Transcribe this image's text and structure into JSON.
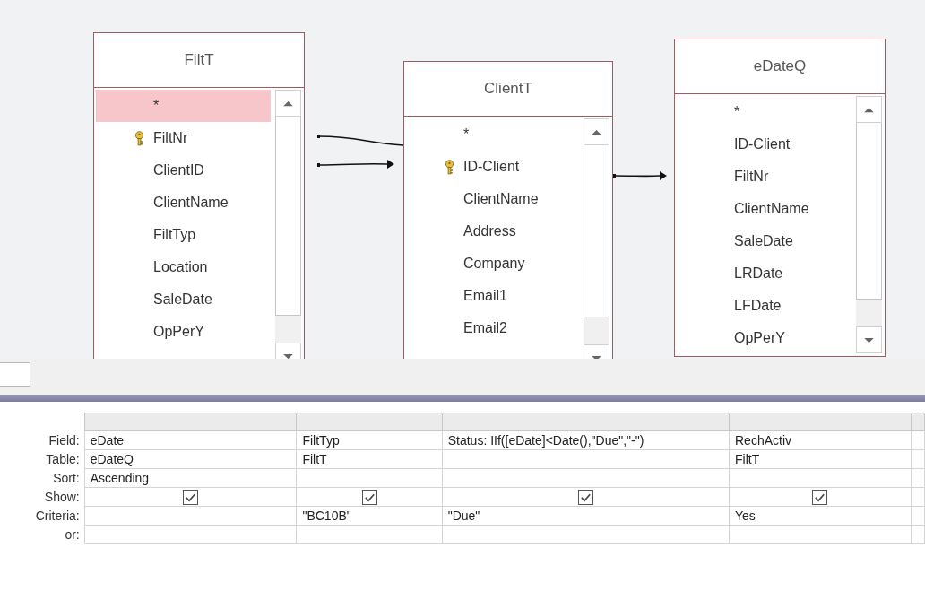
{
  "tables": [
    {
      "title": "FiltT",
      "fields": [
        {
          "name": "*",
          "key": false,
          "selected": true
        },
        {
          "name": "FiltNr",
          "key": true,
          "selected": false
        },
        {
          "name": "ClientID",
          "key": false,
          "selected": false
        },
        {
          "name": "ClientName",
          "key": false,
          "selected": false
        },
        {
          "name": "FiltTyp",
          "key": false,
          "selected": false
        },
        {
          "name": "Location",
          "key": false,
          "selected": false
        },
        {
          "name": "SaleDate",
          "key": false,
          "selected": false
        },
        {
          "name": "OpPerY",
          "key": false,
          "selected": false
        }
      ]
    },
    {
      "title": "ClientT",
      "fields": [
        {
          "name": "*",
          "key": false,
          "selected": false
        },
        {
          "name": "ID-Client",
          "key": true,
          "selected": false
        },
        {
          "name": "ClientName",
          "key": false,
          "selected": false
        },
        {
          "name": "Address",
          "key": false,
          "selected": false
        },
        {
          "name": "Company",
          "key": false,
          "selected": false
        },
        {
          "name": "Email1",
          "key": false,
          "selected": false
        },
        {
          "name": "Email2",
          "key": false,
          "selected": false
        }
      ]
    },
    {
      "title": "eDateQ",
      "fields": [
        {
          "name": "*",
          "key": false,
          "selected": false
        },
        {
          "name": "ID-Client",
          "key": false,
          "selected": false
        },
        {
          "name": "FiltNr",
          "key": false,
          "selected": false
        },
        {
          "name": "ClientName",
          "key": false,
          "selected": false
        },
        {
          "name": "SaleDate",
          "key": false,
          "selected": false
        },
        {
          "name": "LRDate",
          "key": false,
          "selected": false
        },
        {
          "name": "LFDate",
          "key": false,
          "selected": false
        },
        {
          "name": "OpPerY",
          "key": false,
          "selected": false
        }
      ]
    }
  ],
  "grid": {
    "row_labels": [
      "Field:",
      "Table:",
      "Sort:",
      "Show:",
      "Criteria:",
      "or:"
    ],
    "columns": [
      {
        "field": "eDate",
        "table": "eDateQ",
        "sort": "Ascending",
        "show": true
      },
      {
        "field": "FiltTyp",
        "table": "FiltT",
        "show": true,
        "criteria": "\"BC10B\""
      },
      {
        "field": "Status: IIf([eDate]<Date(),\"Due\",\"-\")",
        "show": true,
        "criteria": "\"Due\""
      },
      {
        "field": "RechActiv",
        "table": "FiltT",
        "show": true,
        "criteria": "Yes"
      }
    ]
  }
}
